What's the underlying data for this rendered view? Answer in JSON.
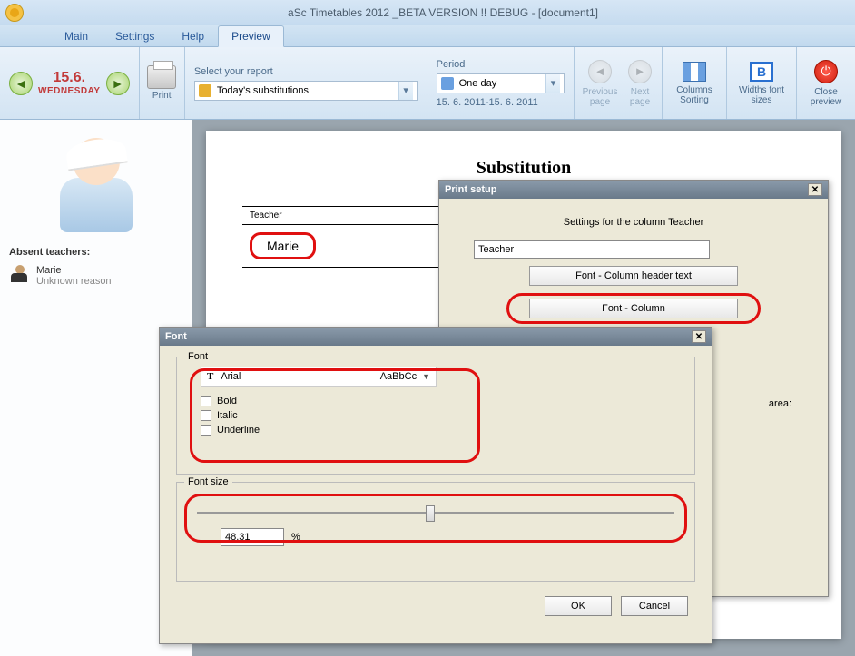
{
  "titlebar": {
    "text": "aSc Timetables 2012 _BETA VERSION !! DEBUG - [document1]"
  },
  "tabs": {
    "main": "Main",
    "settings": "Settings",
    "help": "Help",
    "preview": "Preview"
  },
  "ribbon": {
    "date_num": "15.6.",
    "date_day": "WEDNESDAY",
    "print": "Print",
    "report_header": "Select your report",
    "report_value": "Today's substitutions",
    "period_header": "Period",
    "period_value": "One day",
    "period_range": "15. 6. 2011-15. 6. 2011",
    "prev_page": "Previous page",
    "next_page": "Next page",
    "cols_sort": "Columns Sorting",
    "widths": "Widths font sizes",
    "close": "Close preview"
  },
  "sidebar": {
    "section": "Absent teachers:",
    "teacher_name": "Marie",
    "teacher_reason": "Unknown reason"
  },
  "document": {
    "title": "Substitution",
    "col_teacher": "Teacher",
    "cell_marie": "Marie"
  },
  "print_dialog": {
    "title": "Print setup",
    "header": "Settings for the column Teacher",
    "input": "Teacher",
    "btn_header": "Font - Column header text",
    "btn_column": "Font - Column",
    "area": "area:"
  },
  "font_dialog": {
    "title": "Font",
    "legend_font": "Font",
    "font_name": "Arial",
    "font_sample": "AaBbCc",
    "bold": "Bold",
    "italic": "Italic",
    "underline": "Underline",
    "legend_size": "Font size",
    "size_value": "48.31",
    "percent": "%",
    "ok": "OK",
    "cancel": "Cancel"
  }
}
